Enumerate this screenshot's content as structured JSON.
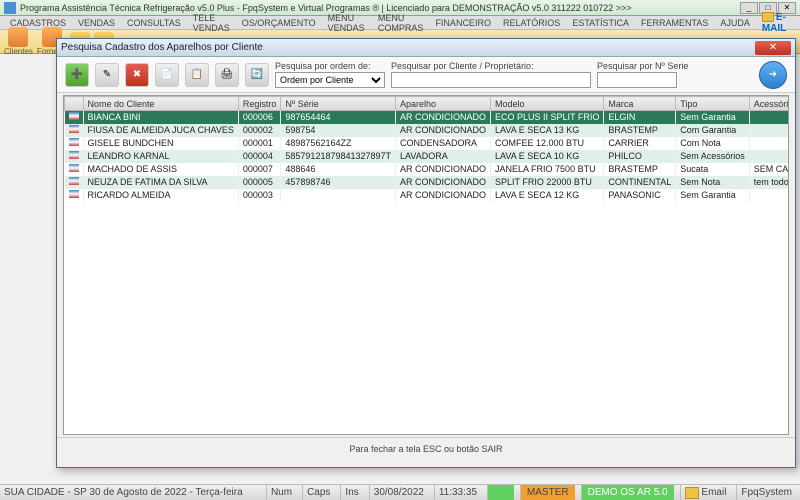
{
  "main_window": {
    "title": "Programa Assistência Técnica Refrigeração v5.0 Plus - FpqSystem e Virtual Programas ® | Licenciado para  DEMONSTRAÇÃO v5.0 311222 010722 >>>"
  },
  "menubar": {
    "items": [
      "CADASTROS",
      "VENDAS",
      "CONSULTAS",
      "TELE VENDAS",
      "OS/ORÇAMENTO",
      "MENU VENDAS",
      "MENU COMPRAS",
      "FINANCEIRO",
      "RELATÓRIOS",
      "ESTATÍSTICA",
      "FERRAMENTAS",
      "AJUDA"
    ],
    "email": "E-MAIL"
  },
  "main_toolbar": {
    "clientes": "Clientes",
    "fornec": "Fornece"
  },
  "dialog": {
    "title": "Pesquisa Cadastro dos Aparelhos por Cliente",
    "search_order_label": "Pesquisa por ordem de:",
    "search_order_value": "Ordem por Cliente",
    "search_client_label": "Pesquisar por Cliente / Proprietário:",
    "search_client_value": "",
    "search_serial_label": "Pesquisar por Nº Serie",
    "search_serial_value": "",
    "footer": "Para fechar a tela ESC ou botão SAIR"
  },
  "table": {
    "headers": [
      "Nome do Cliente",
      "Registro",
      "Nº Série",
      "Aparelho",
      "Modelo",
      "Marca",
      "Tipo",
      "Acessórios"
    ],
    "rows": [
      {
        "sel": true,
        "c": [
          "BIANCA BINI",
          "000006",
          "987654464",
          "AR CONDICIONADO",
          "ECO PLUS II SPLIT FRIO",
          "ELGIN",
          "Sem Garantia",
          ""
        ]
      },
      {
        "sel": false,
        "c": [
          "FIUSA DE ALMEIDA JUCA CHAVES",
          "000002",
          "598754",
          "AR CONDICIONADO",
          "LAVA E SECA 13 KG",
          "BRASTEMP",
          "Com Garantia",
          ""
        ]
      },
      {
        "sel": false,
        "c": [
          "GISELE BUNDCHEN",
          "000001",
          "48987562164ZZ",
          "CONDENSADORA",
          "COMFEE 12.000 BTU",
          "CARRIER",
          "Com Nota",
          ""
        ]
      },
      {
        "sel": false,
        "c": [
          "LEANDRO KARNAL",
          "000004",
          "58579121879841327897T",
          "LAVADORA",
          "LAVA E SECA 10 KG",
          "PHILCO",
          "Sem Acessórios",
          ""
        ]
      },
      {
        "sel": false,
        "c": [
          "MACHADO DE ASSIS",
          "000007",
          "488646",
          "AR CONDICIONADO",
          "JANELA FRIO 7500 BTU",
          "BRASTEMP",
          "Sucata",
          "SEM CABOS"
        ]
      },
      {
        "sel": false,
        "c": [
          "NEUZA DE FATIMA DA SILVA",
          "000005",
          "457898746",
          "AR CONDICIONADO",
          "SPLIT FRIO 22000 BTU",
          "CONTINENTAL",
          "Sem Nota",
          "tem todos os cab"
        ]
      },
      {
        "sel": false,
        "c": [
          "RICARDO ALMEIDA",
          "000003",
          "",
          "AR CONDICIONADO",
          "LAVA E SECA 12 KG",
          "PANASONIC",
          "Sem Garantia",
          ""
        ]
      }
    ]
  },
  "statusbar": {
    "location": "SUA CIDADE - SP 30 de Agosto de 2022 - Terça-feira",
    "num": "Num",
    "caps": "Caps",
    "ins": "Ins",
    "date": "30/08/2022",
    "time": "11:33:35",
    "master": "MASTER",
    "demo": "DEMO OS AR 5.0",
    "email": "Email",
    "brand": "FpqSystem"
  },
  "chart_data": {
    "type": "table",
    "title": "Pesquisa Cadastro dos Aparelhos por Cliente",
    "columns": [
      "Nome do Cliente",
      "Registro",
      "Nº Série",
      "Aparelho",
      "Modelo",
      "Marca",
      "Tipo",
      "Acessórios"
    ],
    "rows": [
      [
        "BIANCA BINI",
        "000006",
        "987654464",
        "AR CONDICIONADO",
        "ECO PLUS II SPLIT FRIO",
        "ELGIN",
        "Sem Garantia",
        ""
      ],
      [
        "FIUSA DE ALMEIDA JUCA CHAVES",
        "000002",
        "598754",
        "AR CONDICIONADO",
        "LAVA E SECA 13 KG",
        "BRASTEMP",
        "Com Garantia",
        ""
      ],
      [
        "GISELE BUNDCHEN",
        "000001",
        "48987562164ZZ",
        "CONDENSADORA",
        "COMFEE 12.000 BTU",
        "CARRIER",
        "Com Nota",
        ""
      ],
      [
        "LEANDRO KARNAL",
        "000004",
        "58579121879841327897T",
        "LAVADORA",
        "LAVA E SECA 10 KG",
        "PHILCO",
        "Sem Acessórios",
        ""
      ],
      [
        "MACHADO DE ASSIS",
        "000007",
        "488646",
        "AR CONDICIONADO",
        "JANELA FRIO 7500 BTU",
        "BRASTEMP",
        "Sucata",
        "SEM CABOS"
      ],
      [
        "NEUZA DE FATIMA DA SILVA",
        "000005",
        "457898746",
        "AR CONDICIONADO",
        "SPLIT FRIO 22000 BTU",
        "CONTINENTAL",
        "Sem Nota",
        "tem todos os cab"
      ],
      [
        "RICARDO ALMEIDA",
        "000003",
        "",
        "AR CONDICIONADO",
        "LAVA E SECA 12 KG",
        "PANASONIC",
        "Sem Garantia",
        ""
      ]
    ]
  }
}
